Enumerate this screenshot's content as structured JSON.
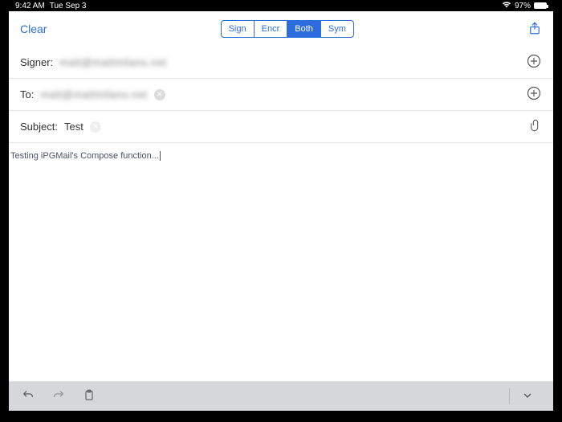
{
  "statusbar": {
    "time": "9:42 AM",
    "date": "Tue Sep 3",
    "battery_pct": "97%"
  },
  "toolbar": {
    "clear_label": "Clear",
    "seg": {
      "sign": "Sign",
      "encr": "Encr",
      "both": "Both",
      "sym": "Sym",
      "active": "both"
    }
  },
  "fields": {
    "signer_label": "Signer:",
    "signer_value": "matt@mattmilano.net",
    "to_label": "To:",
    "to_value": "matt@mattmilano.net",
    "subject_label": "Subject:",
    "subject_value": "Test"
  },
  "body": {
    "text": "Testing iPGMail's Compose function..."
  }
}
